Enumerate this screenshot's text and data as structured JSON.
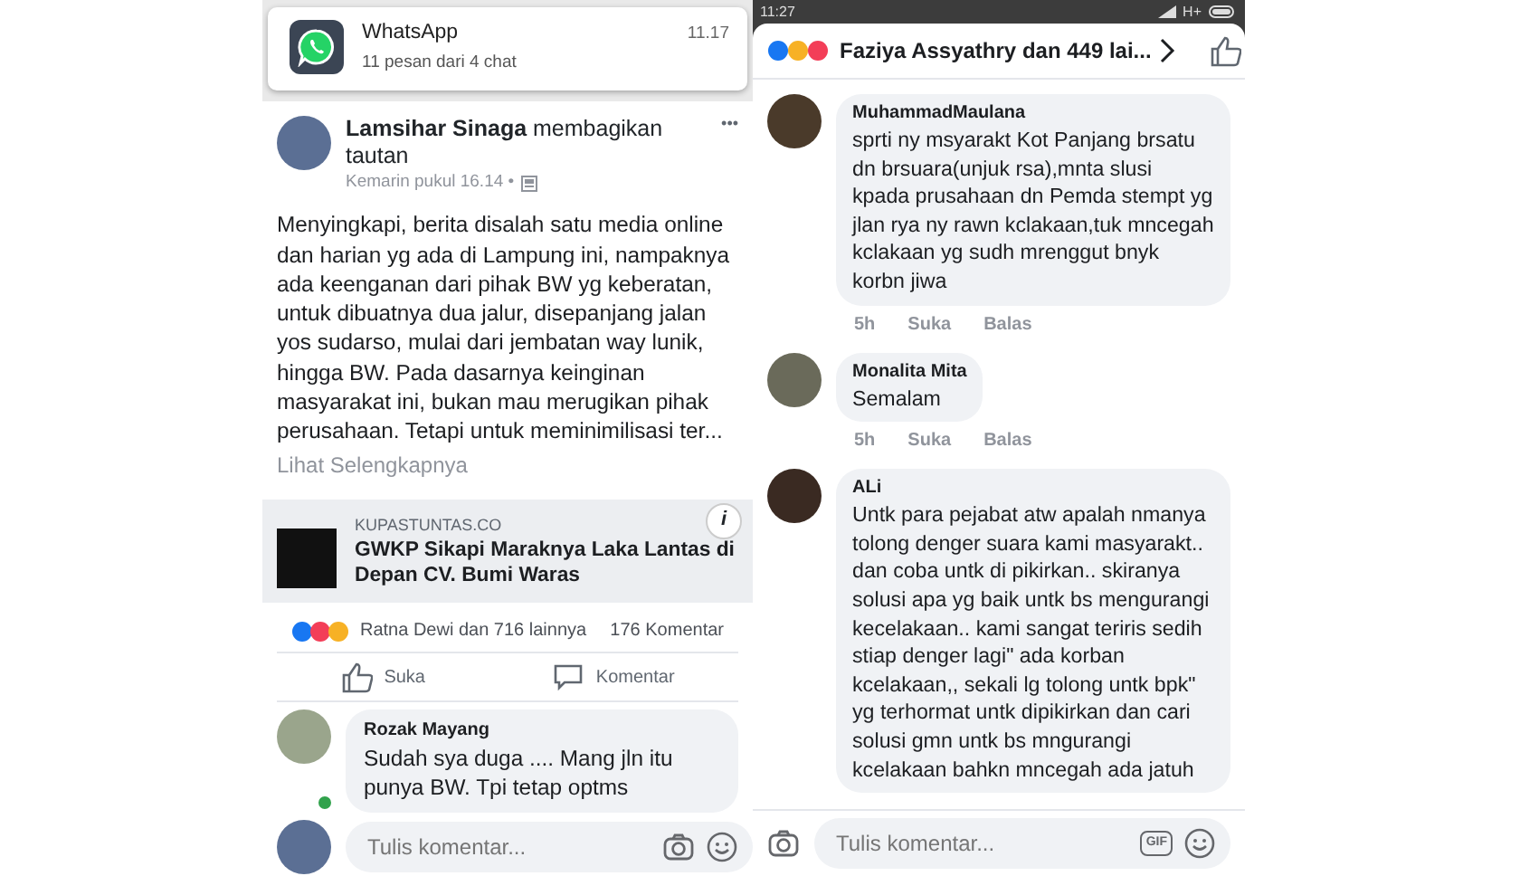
{
  "notification": {
    "app": "WhatsApp",
    "time": "11.17",
    "text": "11 pesan dari 4 chat"
  },
  "post": {
    "author": "Lamsihar Sinaga",
    "action": "membagikan tautan",
    "time": "Kemarin pukul 16.14 •",
    "more": "•••",
    "text": "Menyingkapi,  berita disalah satu media online dan harian yg ada di Lampung ini,  nampaknya ada keenganan dari pihak BW yg keberatan, untuk dibuatnya dua jalur,  disepanjang jalan yos sudarso,  mulai dari jembatan way lunik, hingga BW.  Pada dasarnya keinginan masyarakat ini,  bukan mau merugikan pihak perusahaan.  Tetapi untuk meminimilisasi ter...",
    "see_more": "Lihat Selengkapnya",
    "link": {
      "source": "KUPASTUNTAS.CO",
      "title": "GWKP Sikapi Maraknya Laka Lantas di Depan CV. Bumi Waras",
      "info": "i"
    },
    "reactions": "Ratna Dewi dan 716 lainnya",
    "comments_count": "176 Komentar",
    "actions": [
      "Suka",
      "Komentar"
    ],
    "comment": {
      "name": "Rozak Mayang",
      "text": "Sudah sya duga .... Mang jln itu punya BW. Tpi tetap optms",
      "online": true
    },
    "composer": {
      "placeholder": "Tulis komentar..."
    }
  },
  "phone": {
    "time": "11:27",
    "network": "H+"
  },
  "thread": {
    "reactions": "Faziya Assyathry dan 449 lai...",
    "comments": [
      {
        "name": "MuhammadMaulana",
        "text": "sprti ny msyarakt Kot Panjang brsatu dn brsuara(unjuk rsa),mnta slusi kpada prusahaan dn Pemda stempt yg jlan rya ny rawn kclakaan,tuk mncegah kclakaan yg sudh mrenggut bnyk korbn jiwa",
        "time": "5h",
        "like": "Suka",
        "reply": "Balas"
      },
      {
        "name": "Monalita Mita",
        "text": "Semalam",
        "time": "5h",
        "like": "Suka",
        "reply": "Balas"
      },
      {
        "name": "ALi",
        "text": "Untk para pejabat atw apalah nmanya tolong denger suara kami masyarakt.. dan coba untk di pikirkan.. skiranya solusi apa yg baik untk bs mengurangi kecelakaan.. kami sangat teriris sedih stiap denger lagi\" ada korban kcelakaan,, sekali lg tolong untk bpk\" yg terhormat untk dipikirkan dan cari solusi gmn untk bs mngurangi kcelakaan bahkn mncegah ada jatuh"
      }
    ],
    "composer": {
      "placeholder": "Tulis komentar...",
      "gif": "GIF"
    }
  }
}
